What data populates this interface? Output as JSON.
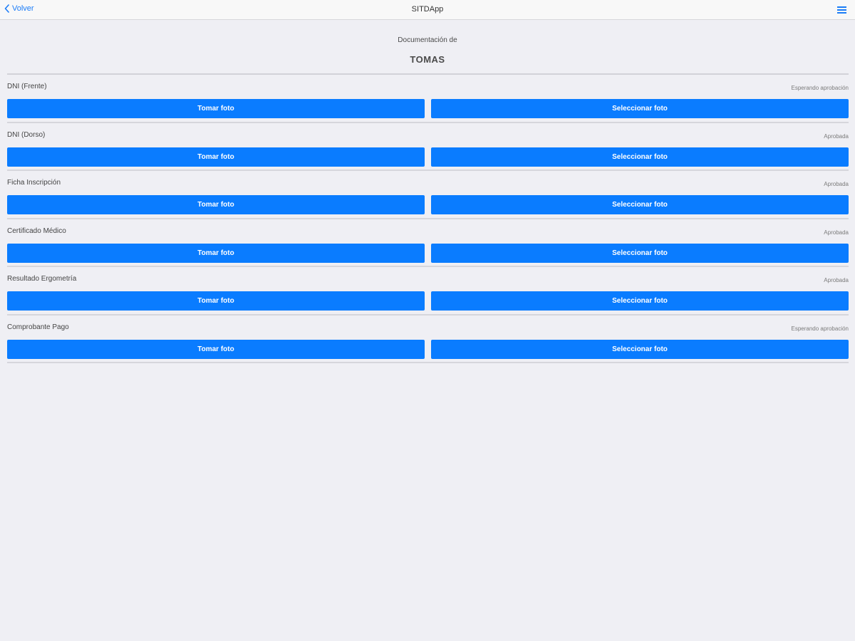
{
  "navbar": {
    "back_label": "Volver",
    "title": "SITDApp",
    "accent_color": "#1b7cf7"
  },
  "header": {
    "subtitle": "Documentación de",
    "name": "TOMAS"
  },
  "documents": [
    {
      "label": "DNI (Frente)",
      "status": "Esperando aprobación",
      "take_label": "Tomar foto",
      "select_label": "Seleccionar foto"
    },
    {
      "label": "DNI (Dorso)",
      "status": "Aprobada",
      "take_label": "Tomar foto",
      "select_label": "Seleccionar foto"
    },
    {
      "label": "Ficha Inscripción",
      "status": "Aprobada",
      "take_label": "Tomar foto",
      "select_label": "Seleccionar foto"
    },
    {
      "label": "Certificado Médico",
      "status": "Aprobada",
      "take_label": "Tomar foto",
      "select_label": "Seleccionar foto"
    },
    {
      "label": "Resultado Ergometría",
      "status": "Aprobada",
      "take_label": "Tomar foto",
      "select_label": "Seleccionar foto"
    },
    {
      "label": "Comprobante Pago",
      "status": "Esperando aprobación",
      "take_label": "Tomar foto",
      "select_label": "Seleccionar foto"
    }
  ],
  "icons": {
    "back": "chevron-left-icon",
    "menu": "hamburger-menu-icon"
  },
  "button_color": "#0a7cff"
}
